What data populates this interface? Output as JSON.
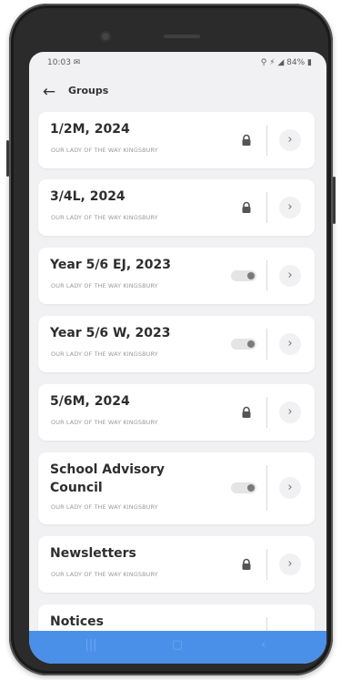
{
  "status_bar": {
    "time": "10:03 ✉",
    "right": "⚲ ⚡ ◢ 84% ▮"
  },
  "app_bar": {
    "back_icon": "arrow-left-icon",
    "title": "Groups"
  },
  "groups": [
    {
      "name": "1/2M, 2024",
      "school": "OUR LADY OF THE WAY KINGSBURY",
      "control": "lock"
    },
    {
      "name": "3/4L, 2024",
      "school": "OUR LADY OF THE WAY KINGSBURY",
      "control": "lock"
    },
    {
      "name": "Year 5/6 EJ, 2023",
      "school": "OUR LADY OF THE WAY KINGSBURY",
      "control": "toggle"
    },
    {
      "name": "Year 5/6 W, 2023",
      "school": "OUR LADY OF THE WAY KINGSBURY",
      "control": "toggle"
    },
    {
      "name": "5/6M, 2024",
      "school": "OUR LADY OF THE WAY KINGSBURY",
      "control": "lock"
    },
    {
      "name": "School Advisory Council",
      "school": "OUR LADY OF THE WAY KINGSBURY",
      "control": "toggle"
    },
    {
      "name": "Newsletters",
      "school": "OUR LADY OF THE WAY KINGSBURY",
      "control": "lock"
    },
    {
      "name": "Notices",
      "school": "",
      "control": "lock"
    }
  ],
  "icons": {
    "chevron": "›",
    "back": "←",
    "nav_recents": "|||",
    "nav_home": "▢",
    "nav_back": "‹"
  },
  "colors": {
    "nav_bar": "#4a90e8",
    "screen_bg": "#f1f1f3",
    "card_bg": "#ffffff"
  }
}
